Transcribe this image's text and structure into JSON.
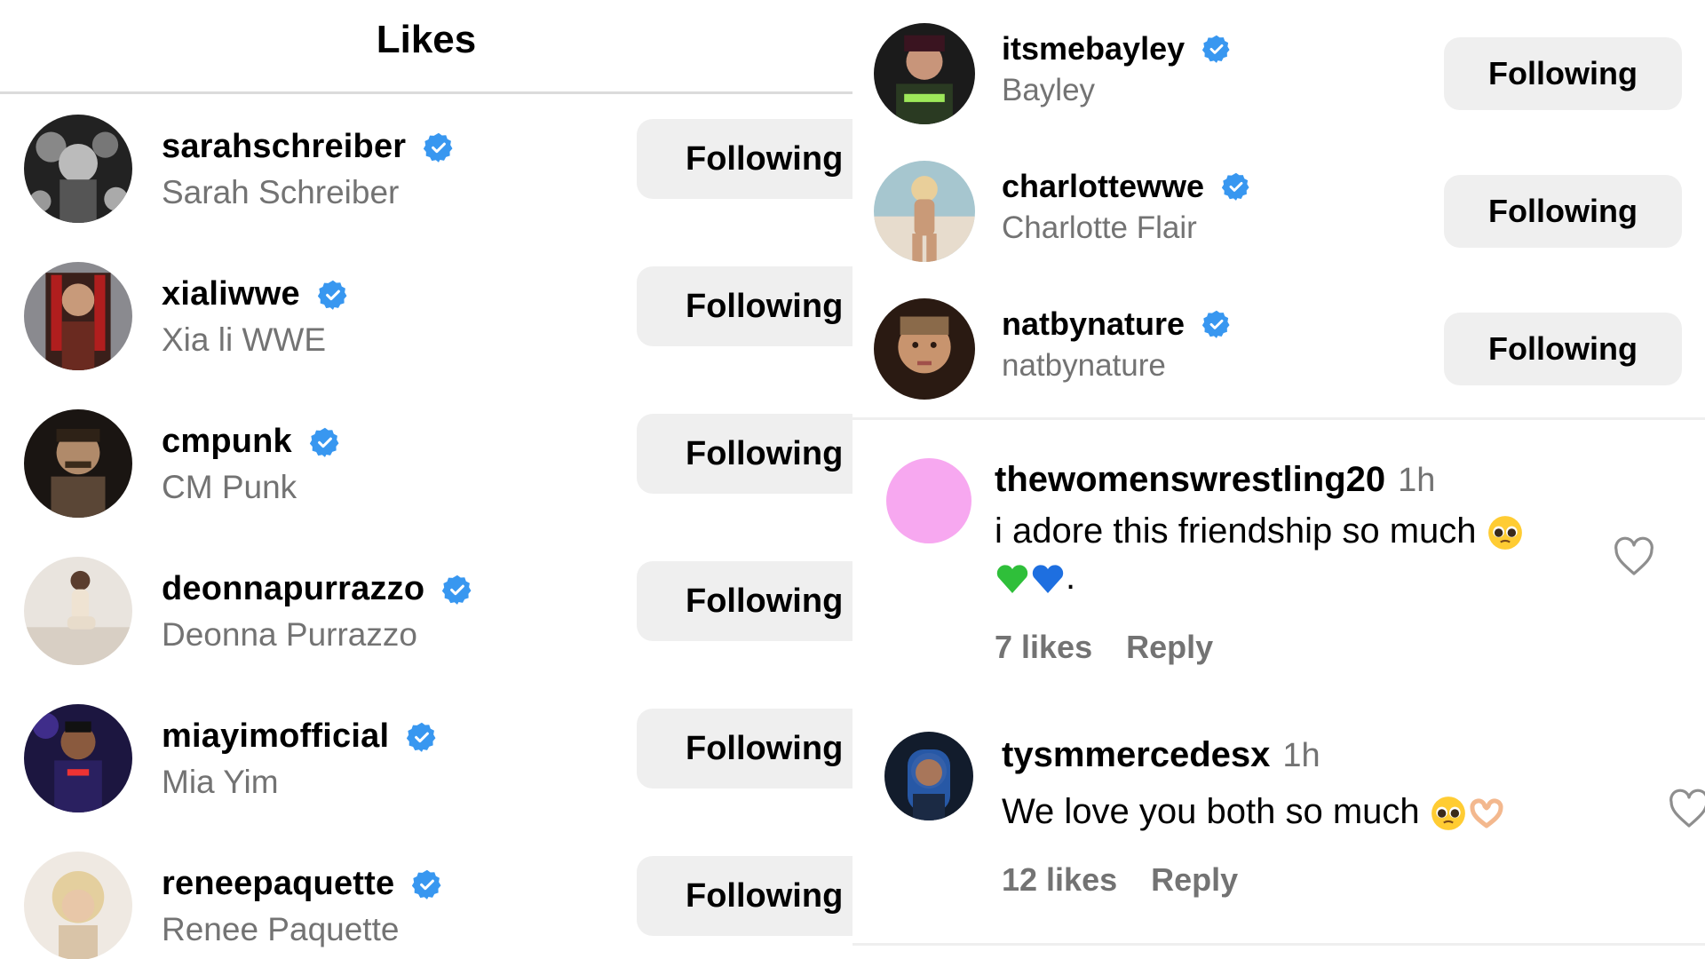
{
  "likes_panel": {
    "title": "Likes",
    "users": [
      {
        "username": "sarahschreiber",
        "full_name": "Sarah Schreiber",
        "button": "Following",
        "verified": true
      },
      {
        "username": "xialiwwe",
        "full_name": "Xia li WWE",
        "button": "Following",
        "verified": true
      },
      {
        "username": "cmpunk",
        "full_name": "CM Punk",
        "button": "Following",
        "verified": true
      },
      {
        "username": "deonnapurrazzo",
        "full_name": "Deonna Purrazzo",
        "button": "Following",
        "verified": true
      },
      {
        "username": "miayimofficial",
        "full_name": "Mia Yim",
        "button": "Following",
        "verified": true
      },
      {
        "username": "reneepaquette",
        "full_name": "Renee Paquette",
        "button": "Following",
        "verified": true
      }
    ]
  },
  "right_panel": {
    "users": [
      {
        "username": "itsmebayley",
        "full_name": "Bayley",
        "button": "Following",
        "verified": true
      },
      {
        "username": "charlottewwe",
        "full_name": "Charlotte Flair",
        "button": "Following",
        "verified": true
      },
      {
        "username": "natbynature",
        "full_name": "natbynature",
        "button": "Following",
        "verified": true
      }
    ],
    "comments": [
      {
        "username": "thewomenswrestling20",
        "time": "1h",
        "text_line1": "i adore this friendship so much",
        "text_line2": ".",
        "likes": "7 likes",
        "reply": "Reply"
      },
      {
        "username": "tysmmercedesx",
        "time": "1h",
        "text": "We love you both so much",
        "likes": "12 likes",
        "reply": "Reply"
      }
    ]
  },
  "colors": {
    "verified": "#3897f0",
    "button_bg": "#efefef",
    "secondary_text": "#737373",
    "placeholder_avatar": "#f7a8f0"
  },
  "icons": [
    "verified-badge-icon",
    "heart-icon",
    "pleading-face-emoji",
    "green-heart-emoji",
    "blue-heart-emoji",
    "heart-hands-emoji"
  ]
}
